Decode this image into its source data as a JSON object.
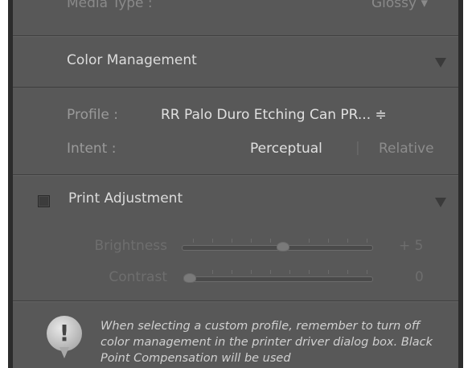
{
  "media_type": {
    "label": "Media Type :",
    "value": "Glossy ▾"
  },
  "color_management": {
    "title": "Color Management",
    "profile_label": "Profile :",
    "profile_value": "RR Palo Duro Etching Can PR... ≑",
    "intent_label": "Intent :",
    "intent_perceptual": "Perceptual",
    "intent_separator": "|",
    "intent_relative": "Relative"
  },
  "print_adjustment": {
    "title": "Print Adjustment",
    "checked": false,
    "brightness_label": "Brightness",
    "brightness_value": "+ 5",
    "contrast_label": "Contrast",
    "contrast_value": "0"
  },
  "note": {
    "text": "When selecting a custom profile, remember to turn off color management in the printer driver dialog box. Black Point Compensation will be used"
  }
}
